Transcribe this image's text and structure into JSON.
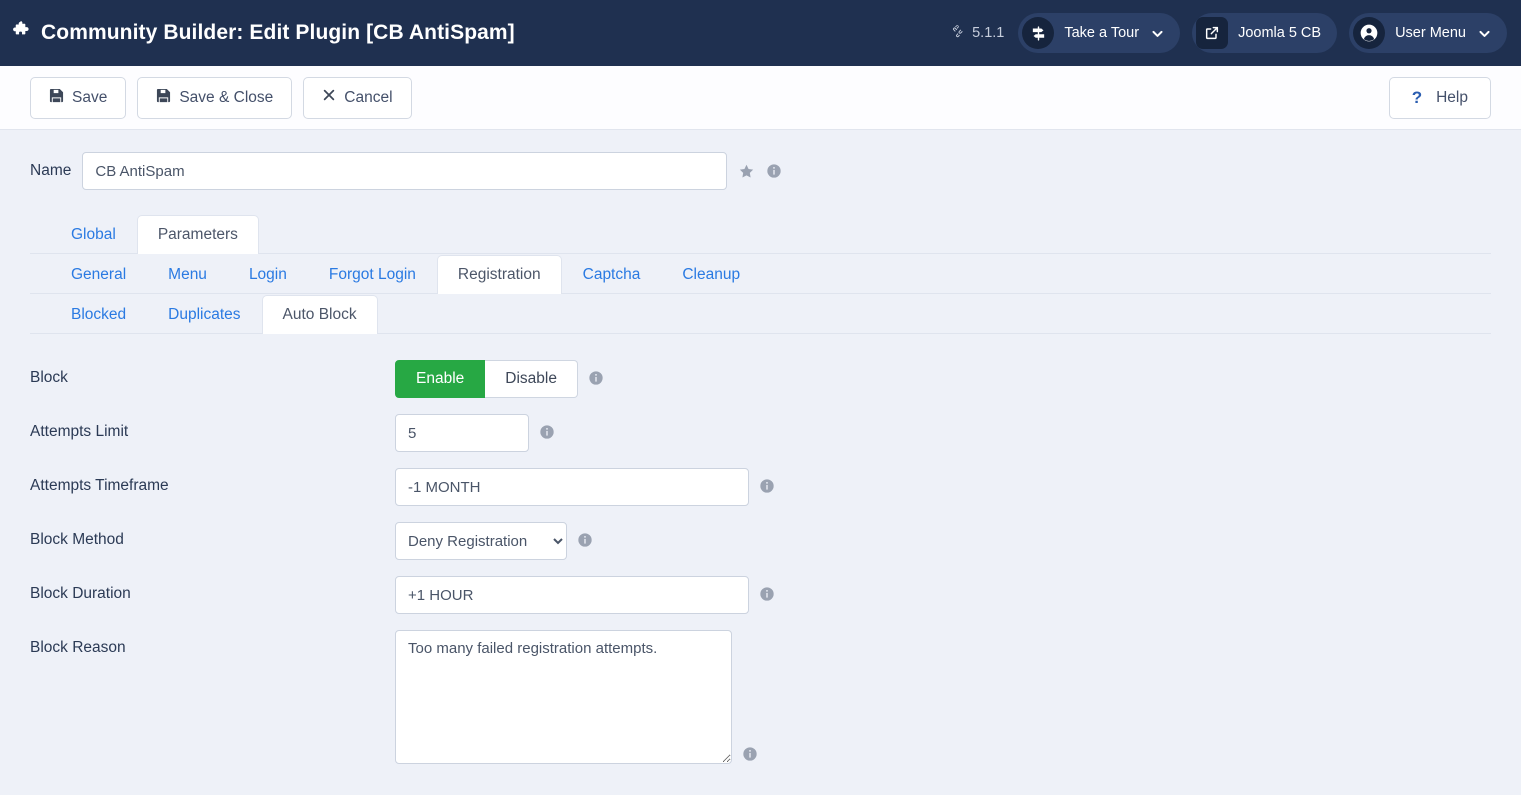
{
  "header": {
    "title": "Community Builder: Edit Plugin [CB AntiSpam]",
    "icon": "puzzle-piece-icon",
    "version": "5.1.1",
    "version_icon": "joomla-icon",
    "tour_button": {
      "label": "Take a Tour",
      "icon": "signpost-icon",
      "chevron": "chevron-down-icon"
    },
    "site_button": {
      "label": "Joomla 5 CB",
      "icon": "external-link-icon"
    },
    "user_menu": {
      "label": "User Menu",
      "icon": "user-circle-icon",
      "chevron": "chevron-down-icon"
    }
  },
  "toolbar": {
    "save_label": "Save",
    "save_icon": "floppy-disk-icon",
    "save_close_label": "Save & Close",
    "save_close_icon": "floppy-disk-icon",
    "cancel_label": "Cancel",
    "cancel_icon": "close-x-icon",
    "help_label": "Help",
    "help_icon": "question-mark-icon"
  },
  "name_field": {
    "label": "Name",
    "value": "CB AntiSpam",
    "placeholder": "",
    "star_icon": "star-icon",
    "info_icon": "info-icon"
  },
  "tabs_level1": [
    {
      "label": "Global",
      "active": false
    },
    {
      "label": "Parameters",
      "active": true
    }
  ],
  "tabs_level2": [
    {
      "label": "General",
      "active": false
    },
    {
      "label": "Menu",
      "active": false
    },
    {
      "label": "Login",
      "active": false
    },
    {
      "label": "Forgot Login",
      "active": false
    },
    {
      "label": "Registration",
      "active": true
    },
    {
      "label": "Captcha",
      "active": false
    },
    {
      "label": "Cleanup",
      "active": false
    }
  ],
  "tabs_level3": [
    {
      "label": "Blocked",
      "active": false
    },
    {
      "label": "Duplicates",
      "active": false
    },
    {
      "label": "Auto Block",
      "active": true
    }
  ],
  "form": {
    "block": {
      "label": "Block",
      "enable_label": "Enable",
      "disable_label": "Disable",
      "selected": "Enable",
      "info_icon": "info-icon"
    },
    "attempts_limit": {
      "label": "Attempts Limit",
      "value": "5",
      "placeholder": "",
      "info_icon": "info-icon"
    },
    "attempts_timeframe": {
      "label": "Attempts Timeframe",
      "value": "-1 MONTH",
      "placeholder": "",
      "info_icon": "info-icon"
    },
    "block_method": {
      "label": "Block Method",
      "value": "Deny Registration",
      "options": [
        "Deny Registration"
      ],
      "info_icon": "info-icon"
    },
    "block_duration": {
      "label": "Block Duration",
      "value": "+1 HOUR",
      "placeholder": "",
      "info_icon": "info-icon"
    },
    "block_reason": {
      "label": "Block Reason",
      "value": "Too many failed registration attempts.",
      "placeholder": "",
      "info_icon": "info-icon"
    }
  },
  "colors": {
    "header_bg": "#1f3050",
    "page_bg": "#eef1f8",
    "accent_link": "#2a7ae2",
    "enable_green": "#27a844",
    "help_blue": "#2a5db0"
  }
}
